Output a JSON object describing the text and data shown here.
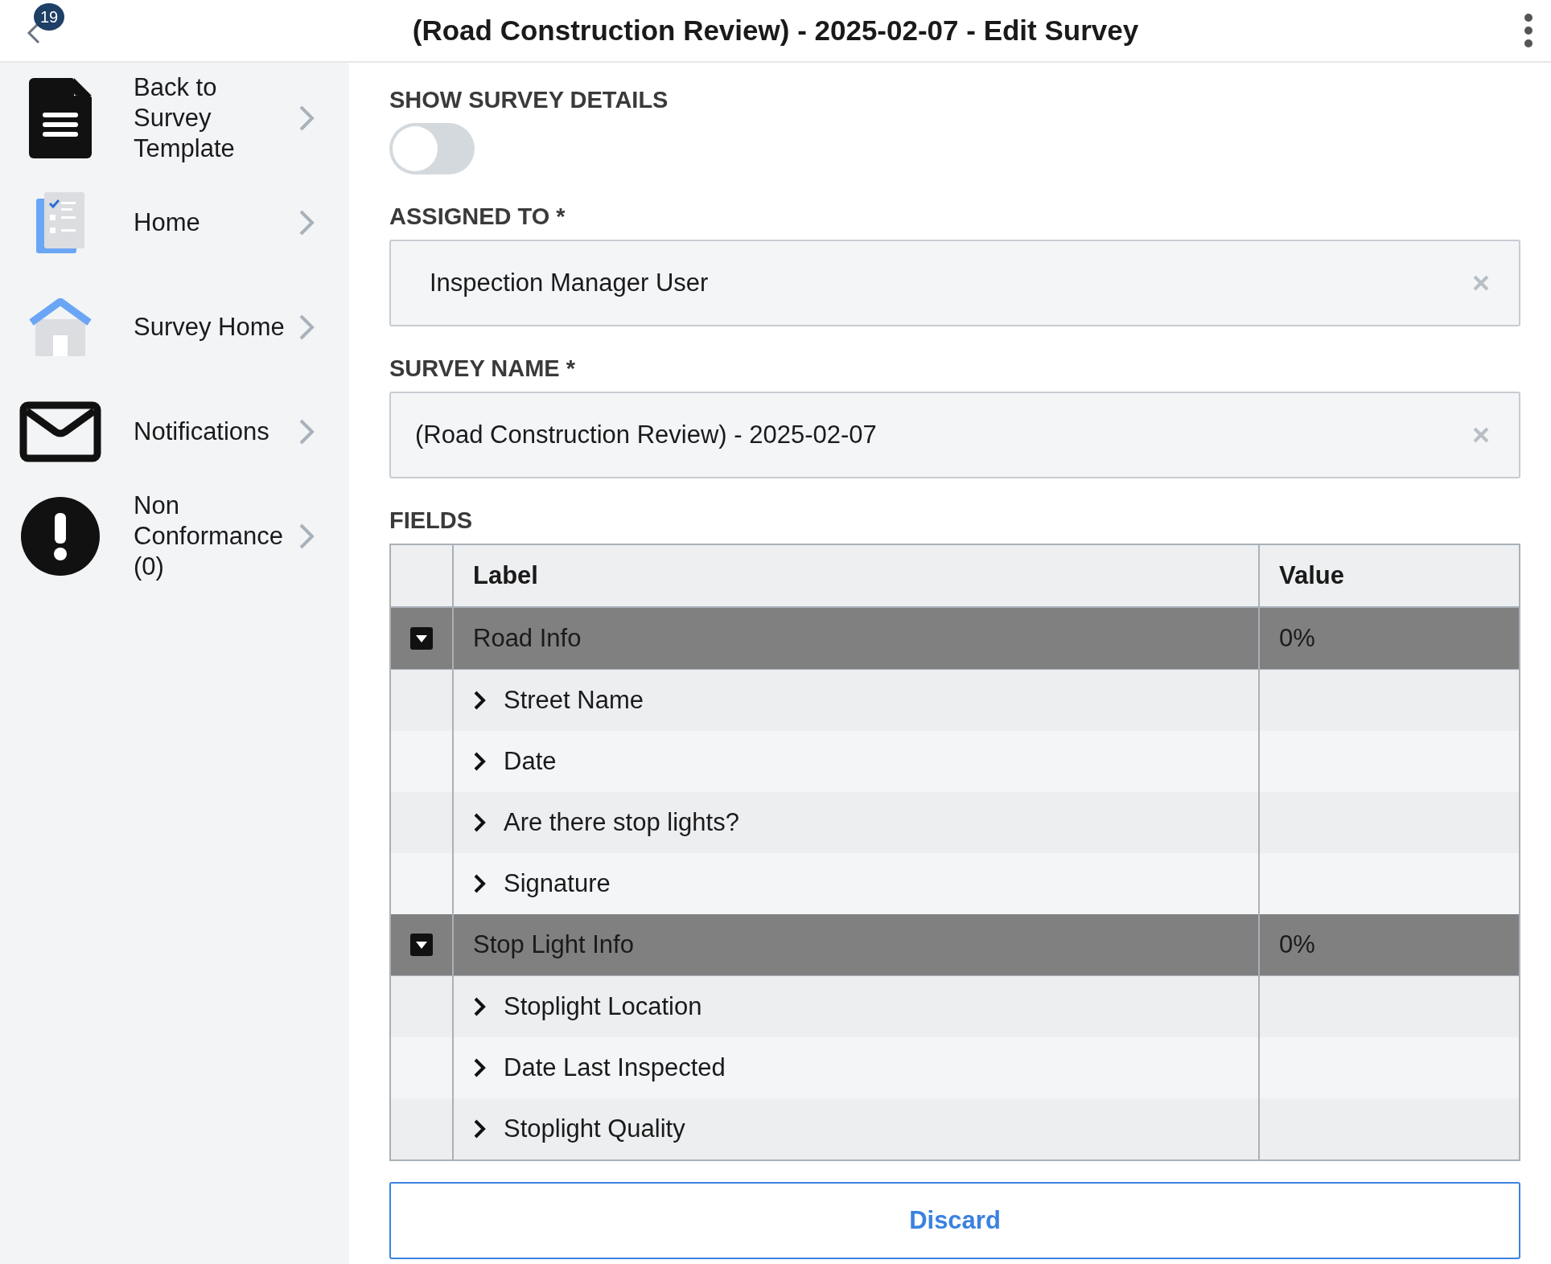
{
  "header": {
    "back_badge": "19",
    "title": "(Road Construction Review) - 2025-02-07 - Edit Survey"
  },
  "sidebar": {
    "items": [
      {
        "label": "Back to Survey Template",
        "kind": "document"
      },
      {
        "label": "Home",
        "kind": "checklist"
      },
      {
        "label": "Survey Home",
        "kind": "house"
      },
      {
        "label": "Notifications",
        "kind": "envelope"
      },
      {
        "label": "Non Conformance (0)",
        "kind": "alert"
      }
    ]
  },
  "show_details": {
    "label": "SHOW SURVEY DETAILS",
    "on": false
  },
  "assigned_to": {
    "label": "ASSIGNED TO *",
    "value": "Inspection Manager User"
  },
  "survey_name": {
    "label": "SURVEY NAME *",
    "value": "(Road Construction Review) - 2025-02-07"
  },
  "fields": {
    "title": "FIELDS",
    "columns": [
      "Label",
      "Value"
    ],
    "groups": [
      {
        "label": "Road Info",
        "value": "0%",
        "expanded": true,
        "children": [
          {
            "label": "Street Name",
            "expanded": false
          },
          {
            "label": "Date",
            "expanded": false
          },
          {
            "label": "Are there stop lights?",
            "expanded": false
          },
          {
            "label": "Signature",
            "expanded": false
          }
        ]
      },
      {
        "label": "Stop Light Info",
        "value": "0%",
        "expanded": true,
        "children": [
          {
            "label": "Stoplight Location",
            "expanded": false
          },
          {
            "label": "Date Last Inspected",
            "expanded": false
          },
          {
            "label": "Stoplight Quality",
            "expanded": false
          }
        ]
      }
    ]
  },
  "discard_button": "Discard"
}
